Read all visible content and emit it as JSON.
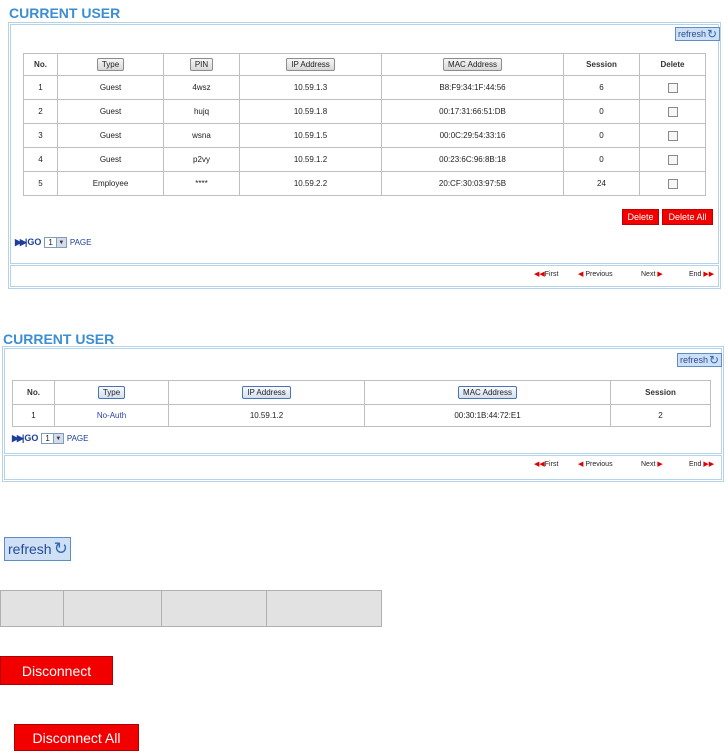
{
  "panel1": {
    "title": "CURRENT USER",
    "refresh_label": "refresh",
    "columns": [
      "No.",
      "Type",
      "PIN",
      "IP Address",
      "MAC Address",
      "Session",
      "Delete"
    ],
    "rows": [
      {
        "no": "1",
        "type": "Guest",
        "pin": "4wsz",
        "ip": "10.59.1.3",
        "mac": "B8:F9:34:1F:44:56",
        "session": "6"
      },
      {
        "no": "2",
        "type": "Guest",
        "pin": "hujq",
        "ip": "10.59.1.8",
        "mac": "00:17:31:66:51:DB",
        "session": "0"
      },
      {
        "no": "3",
        "type": "Guest",
        "pin": "wsna",
        "ip": "10.59.1.5",
        "mac": "00:0C:29:54:33:16",
        "session": "0"
      },
      {
        "no": "4",
        "type": "Guest",
        "pin": "p2vy",
        "ip": "10.59.1.2",
        "mac": "00:23:6C:96:8B:18",
        "session": "0"
      },
      {
        "no": "5",
        "type": "Employee",
        "pin": "****",
        "ip": "10.59.2.2",
        "mac": "20:CF:30:03:97:5B",
        "session": "24"
      }
    ],
    "delete_label": "Delete",
    "delete_all_label": "Delete All",
    "go_label": "GO",
    "page_value": "1",
    "page_word": "PAGE",
    "nav": {
      "first": "First",
      "previous": "Previous",
      "next": "Next",
      "end": "End"
    }
  },
  "panel2": {
    "title": "CURRENT USER",
    "refresh_label": "refresh",
    "columns": [
      "No.",
      "Type",
      "IP Address",
      "MAC Address",
      "Session"
    ],
    "rows": [
      {
        "no": "1",
        "type": "No-Auth",
        "ip": "10.59.1.2",
        "mac": "00:30:1B:44:72:E1",
        "session": "2"
      }
    ],
    "go_label": "GO",
    "page_value": "1",
    "page_word": "PAGE",
    "nav": {
      "first": "First",
      "previous": "Previous",
      "next": "Next",
      "end": "End"
    }
  },
  "samples": {
    "refresh_label": "refresh",
    "disconnect_label": "Disconnect",
    "disconnect_all_label": "Disconnect All"
  },
  "colors": {
    "title_blue": "#3c8ed3",
    "panel_border": "#b5d3e8",
    "red_button": "#f20000",
    "link_blue": "#1b3f9b"
  },
  "icons": [
    "refresh-icon",
    "go-icon",
    "dropdown-arrow-icon",
    "first-icon",
    "previous-icon",
    "next-icon",
    "end-icon"
  ]
}
